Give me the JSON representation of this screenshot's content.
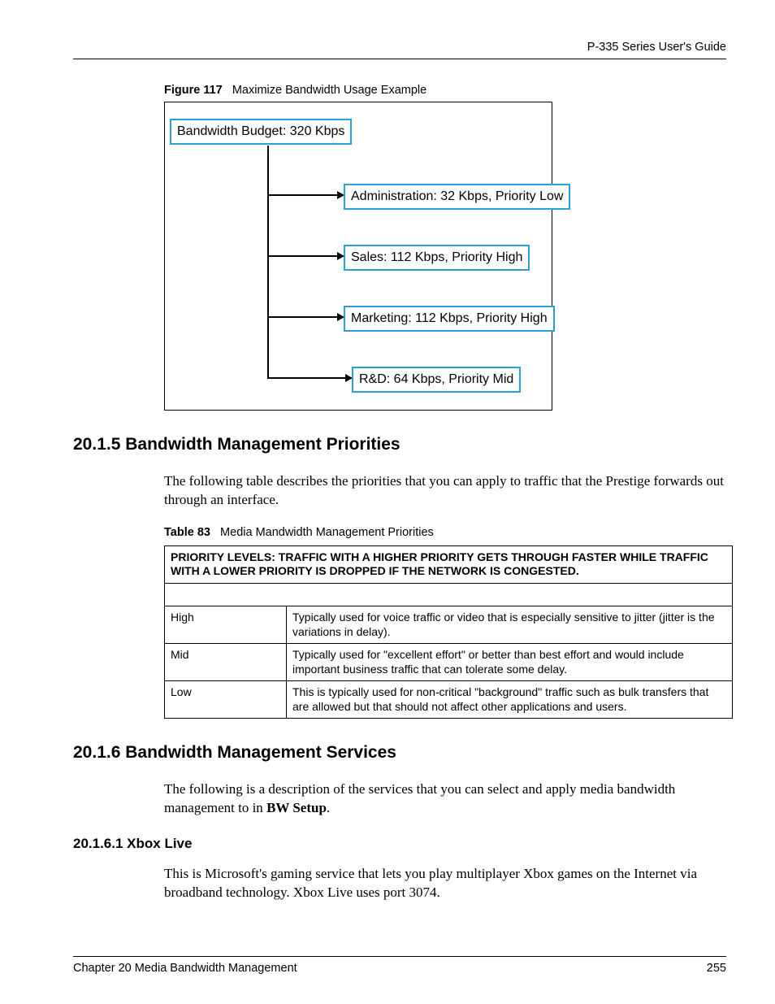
{
  "header": {
    "guide": "P-335 Series User's Guide"
  },
  "figure": {
    "label": "Figure 117",
    "title": "Maximize Bandwidth Usage Example",
    "root": "Bandwidth Budget: 320 Kbps",
    "children": [
      "Administration: 32 Kbps, Priority Low",
      "Sales: 112 Kbps, Priority High",
      "Marketing: 112 Kbps, Priority High",
      "R&D: 64 Kbps, Priority Mid"
    ]
  },
  "section_2015": {
    "heading": "20.1.5  Bandwidth Management Priorities",
    "intro": "The following table describes the priorities that you can apply to traffic that the Prestige forwards out through an interface."
  },
  "table": {
    "label": "Table 83",
    "title": "Media Mandwidth Management Priorities",
    "header": "PRIORITY LEVELS: TRAFFIC WITH A HIGHER PRIORITY GETS THROUGH FASTER WHILE TRAFFIC WITH A LOWER PRIORITY IS DROPPED IF THE NETWORK IS CONGESTED.",
    "rows": [
      {
        "level": "High",
        "desc": "Typically used for voice traffic or video that is especially sensitive to jitter (jitter is the variations in delay)."
      },
      {
        "level": "Mid",
        "desc": "Typically used for \"excellent effort\" or better than best effort and would include important business traffic that can tolerate some delay."
      },
      {
        "level": "Low",
        "desc": "This is typically used for non-critical \"background\" traffic such as bulk transfers that are allowed but that should not affect other applications and users."
      }
    ]
  },
  "section_2016": {
    "heading": "20.1.6  Bandwidth Management Services",
    "intro_pre": "The following is a description of the services that you can select and apply media bandwidth management to in ",
    "intro_bold": "BW Setup",
    "intro_post": "."
  },
  "section_20161": {
    "heading": "20.1.6.1  Xbox Live",
    "body": "This is Microsoft's gaming service that lets you play multiplayer Xbox games on the Internet via broadband technology. Xbox Live uses port 3074."
  },
  "footer": {
    "chapter": "Chapter 20 Media Bandwidth Management",
    "page": "255"
  }
}
